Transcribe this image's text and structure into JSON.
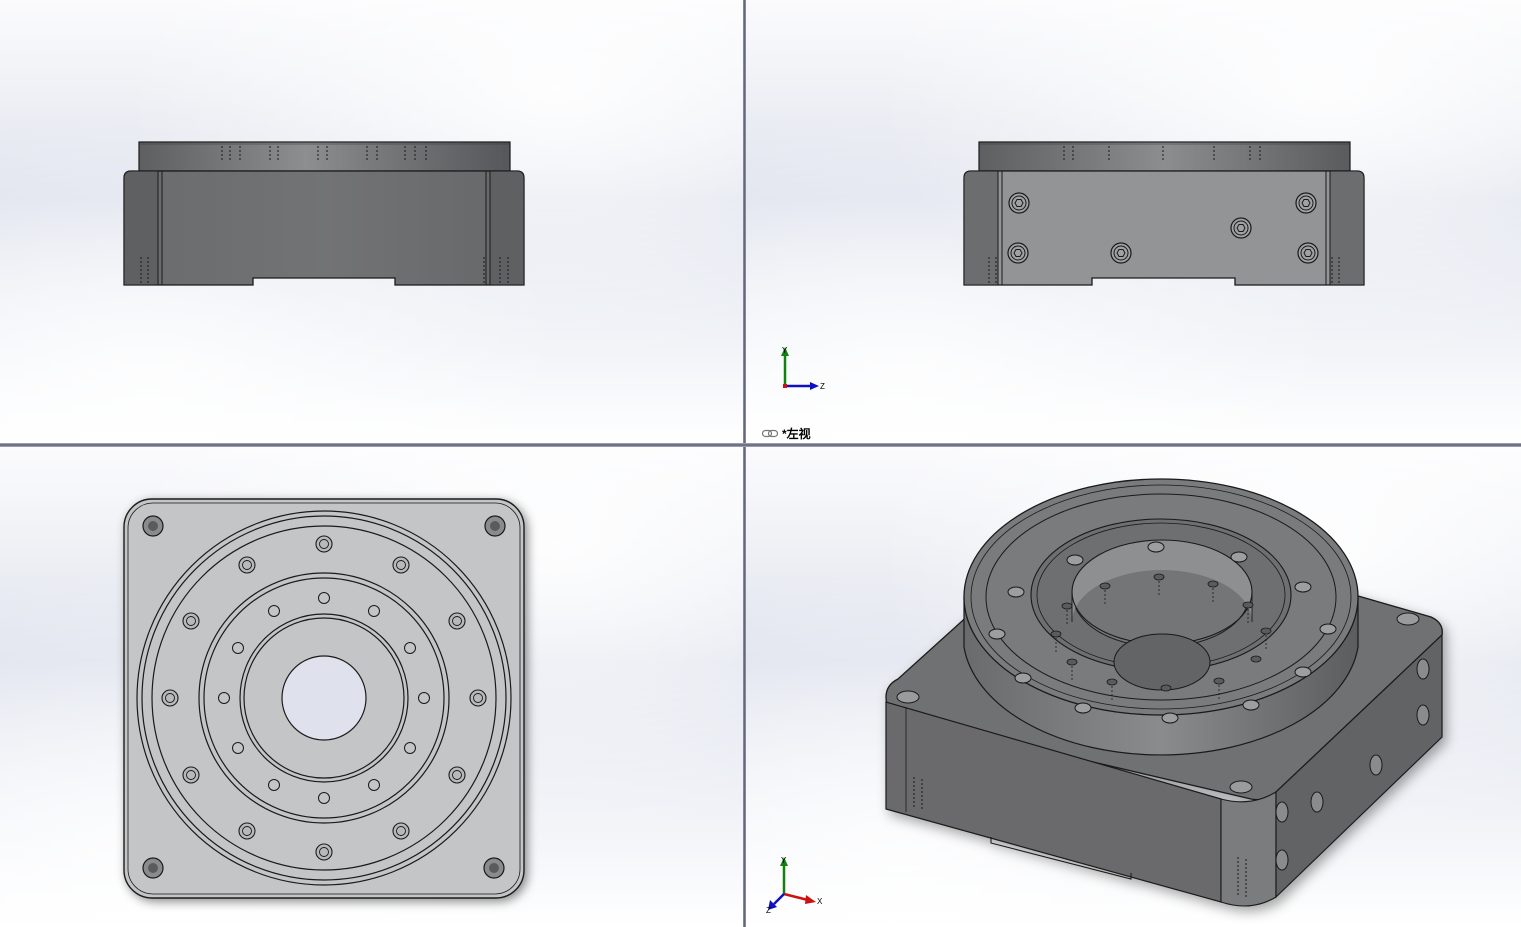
{
  "window": {
    "layout": "four-viewport"
  },
  "viewports": {
    "top_left": {
      "view": "front-orthographic"
    },
    "top_right": {
      "view": "left-orthographic",
      "label": "*左视",
      "link_icon": "link-icon",
      "triad": {
        "y": "Y",
        "z": "Z"
      }
    },
    "bottom_left": {
      "view": "top-orthographic"
    },
    "bottom_right": {
      "view": "isometric",
      "triad": {
        "y": "Y",
        "x": "X",
        "z": "Z"
      }
    }
  },
  "colors": {
    "model_dark": "#6e6f71",
    "model_mid": "#8a8b8d",
    "model_light": "#c4c5c7",
    "edge": "#1a1a1a",
    "axis_x": "#d01010",
    "axis_y": "#108010",
    "axis_z": "#1010c0"
  }
}
